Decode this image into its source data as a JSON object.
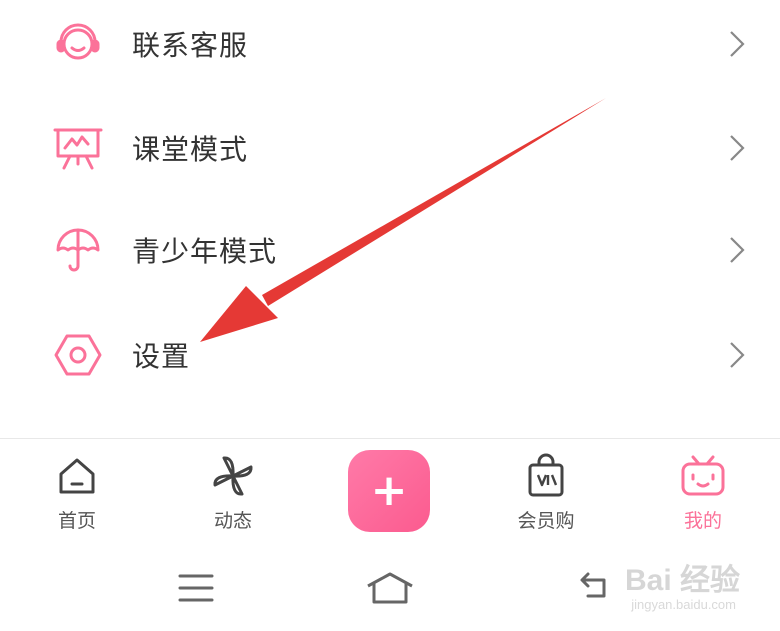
{
  "menu": {
    "items": [
      {
        "label": "联系客服",
        "icon": "headset-icon"
      },
      {
        "label": "课堂模式",
        "icon": "classroom-board-icon"
      },
      {
        "label": "青少年模式",
        "icon": "umbrella-icon"
      },
      {
        "label": "设置",
        "icon": "hexagon-gear-icon"
      }
    ]
  },
  "tabbar": {
    "home": "首页",
    "dynamic": "动态",
    "publish_symbol": "+",
    "vip_shop": "会员购",
    "mine": "我的"
  },
  "watermark": {
    "brand": "Bai 经验",
    "url": "jingyan.baidu.com"
  },
  "colors": {
    "accent": "#fb7299",
    "arrow": "#e53935",
    "text": "#333333"
  }
}
